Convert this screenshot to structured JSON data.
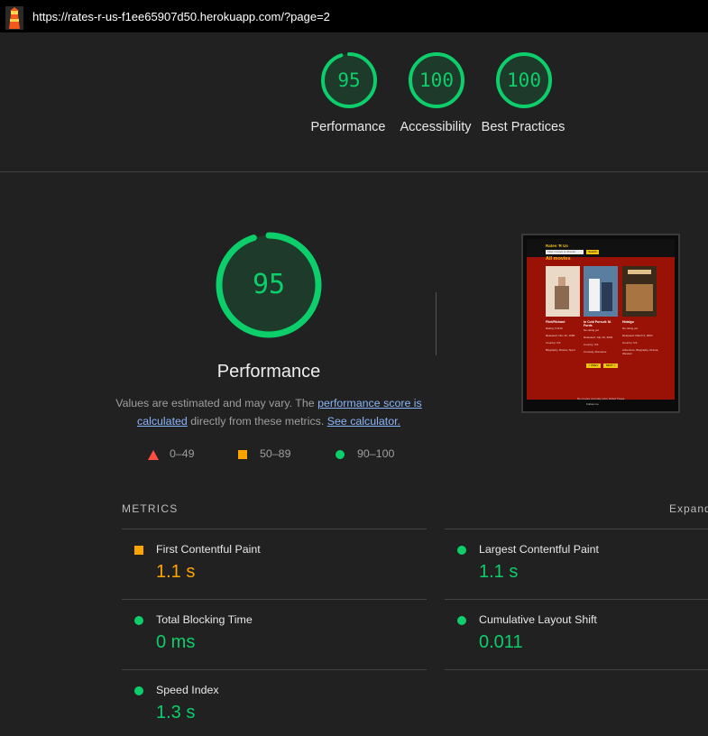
{
  "browser": {
    "url": "https://rates-r-us-f1ee65907d50.herokuapp.com/?page=2"
  },
  "summary": [
    {
      "score": "95",
      "label": "Performance",
      "fraction": 0.95
    },
    {
      "score": "100",
      "label": "Accessibility",
      "fraction": 1.0
    },
    {
      "score": "100",
      "label": "Best Practices",
      "fraction": 1.0
    }
  ],
  "performance": {
    "score": "95",
    "fraction": 0.95,
    "title": "Performance",
    "desc_prefix": "Values are estimated and may vary. The ",
    "link_score": "performance score is calculated",
    "desc_middle": " directly from these metrics. ",
    "link_calc": "See calculator."
  },
  "legend": [
    {
      "range": "0–49",
      "shape": "triangle",
      "color": "#ff4e42"
    },
    {
      "range": "50–89",
      "shape": "square",
      "color": "#ffa400"
    },
    {
      "range": "90–100",
      "shape": "circle",
      "color": "#0cce6b"
    }
  ],
  "screenshot": {
    "brand": "Rates 'R Us",
    "search_placeholder": "Filter movies or director",
    "search_button": "Search",
    "heading": "All movies",
    "movies": [
      {
        "title": "Flint/Richard",
        "lines": [
          "Rating: 5.9/10",
          "Released: Nov 16, 1995",
          "Country: US",
          "Biography, Drama, Sport"
        ]
      },
      {
        "title": "In Cold Pursuit: M. Fords",
        "lines": [
          "No rating yet",
          "Released: July 16, 2004",
          "Country: US",
          "Comedy, Romance"
        ]
      },
      {
        "title": "Hidalgo",
        "lines": [
          "No rating yet",
          "Released: March 5, 2004",
          "Country: US",
          "Adventure, Biography, Drama, Western"
        ]
      }
    ],
    "prev": "< PREV",
    "next": "NEXT >",
    "footer": "No movies currently exist, Rahul Thapa",
    "follow": "Follow me"
  },
  "metrics_section": {
    "header": "METRICS",
    "expand": "Expand view"
  },
  "metrics": [
    {
      "name": "First Contentful Paint",
      "value": "1.1 s",
      "status": "average",
      "color": "#ffa400"
    },
    {
      "name": "Largest Contentful Paint",
      "value": "1.1 s",
      "status": "pass",
      "color": "#0cce6b"
    },
    {
      "name": "Total Blocking Time",
      "value": "0 ms",
      "status": "pass",
      "color": "#0cce6b"
    },
    {
      "name": "Cumulative Layout Shift",
      "value": "0.011",
      "status": "pass",
      "color": "#0cce6b"
    },
    {
      "name": "Speed Index",
      "value": "1.3 s",
      "status": "pass",
      "color": "#0cce6b"
    }
  ]
}
